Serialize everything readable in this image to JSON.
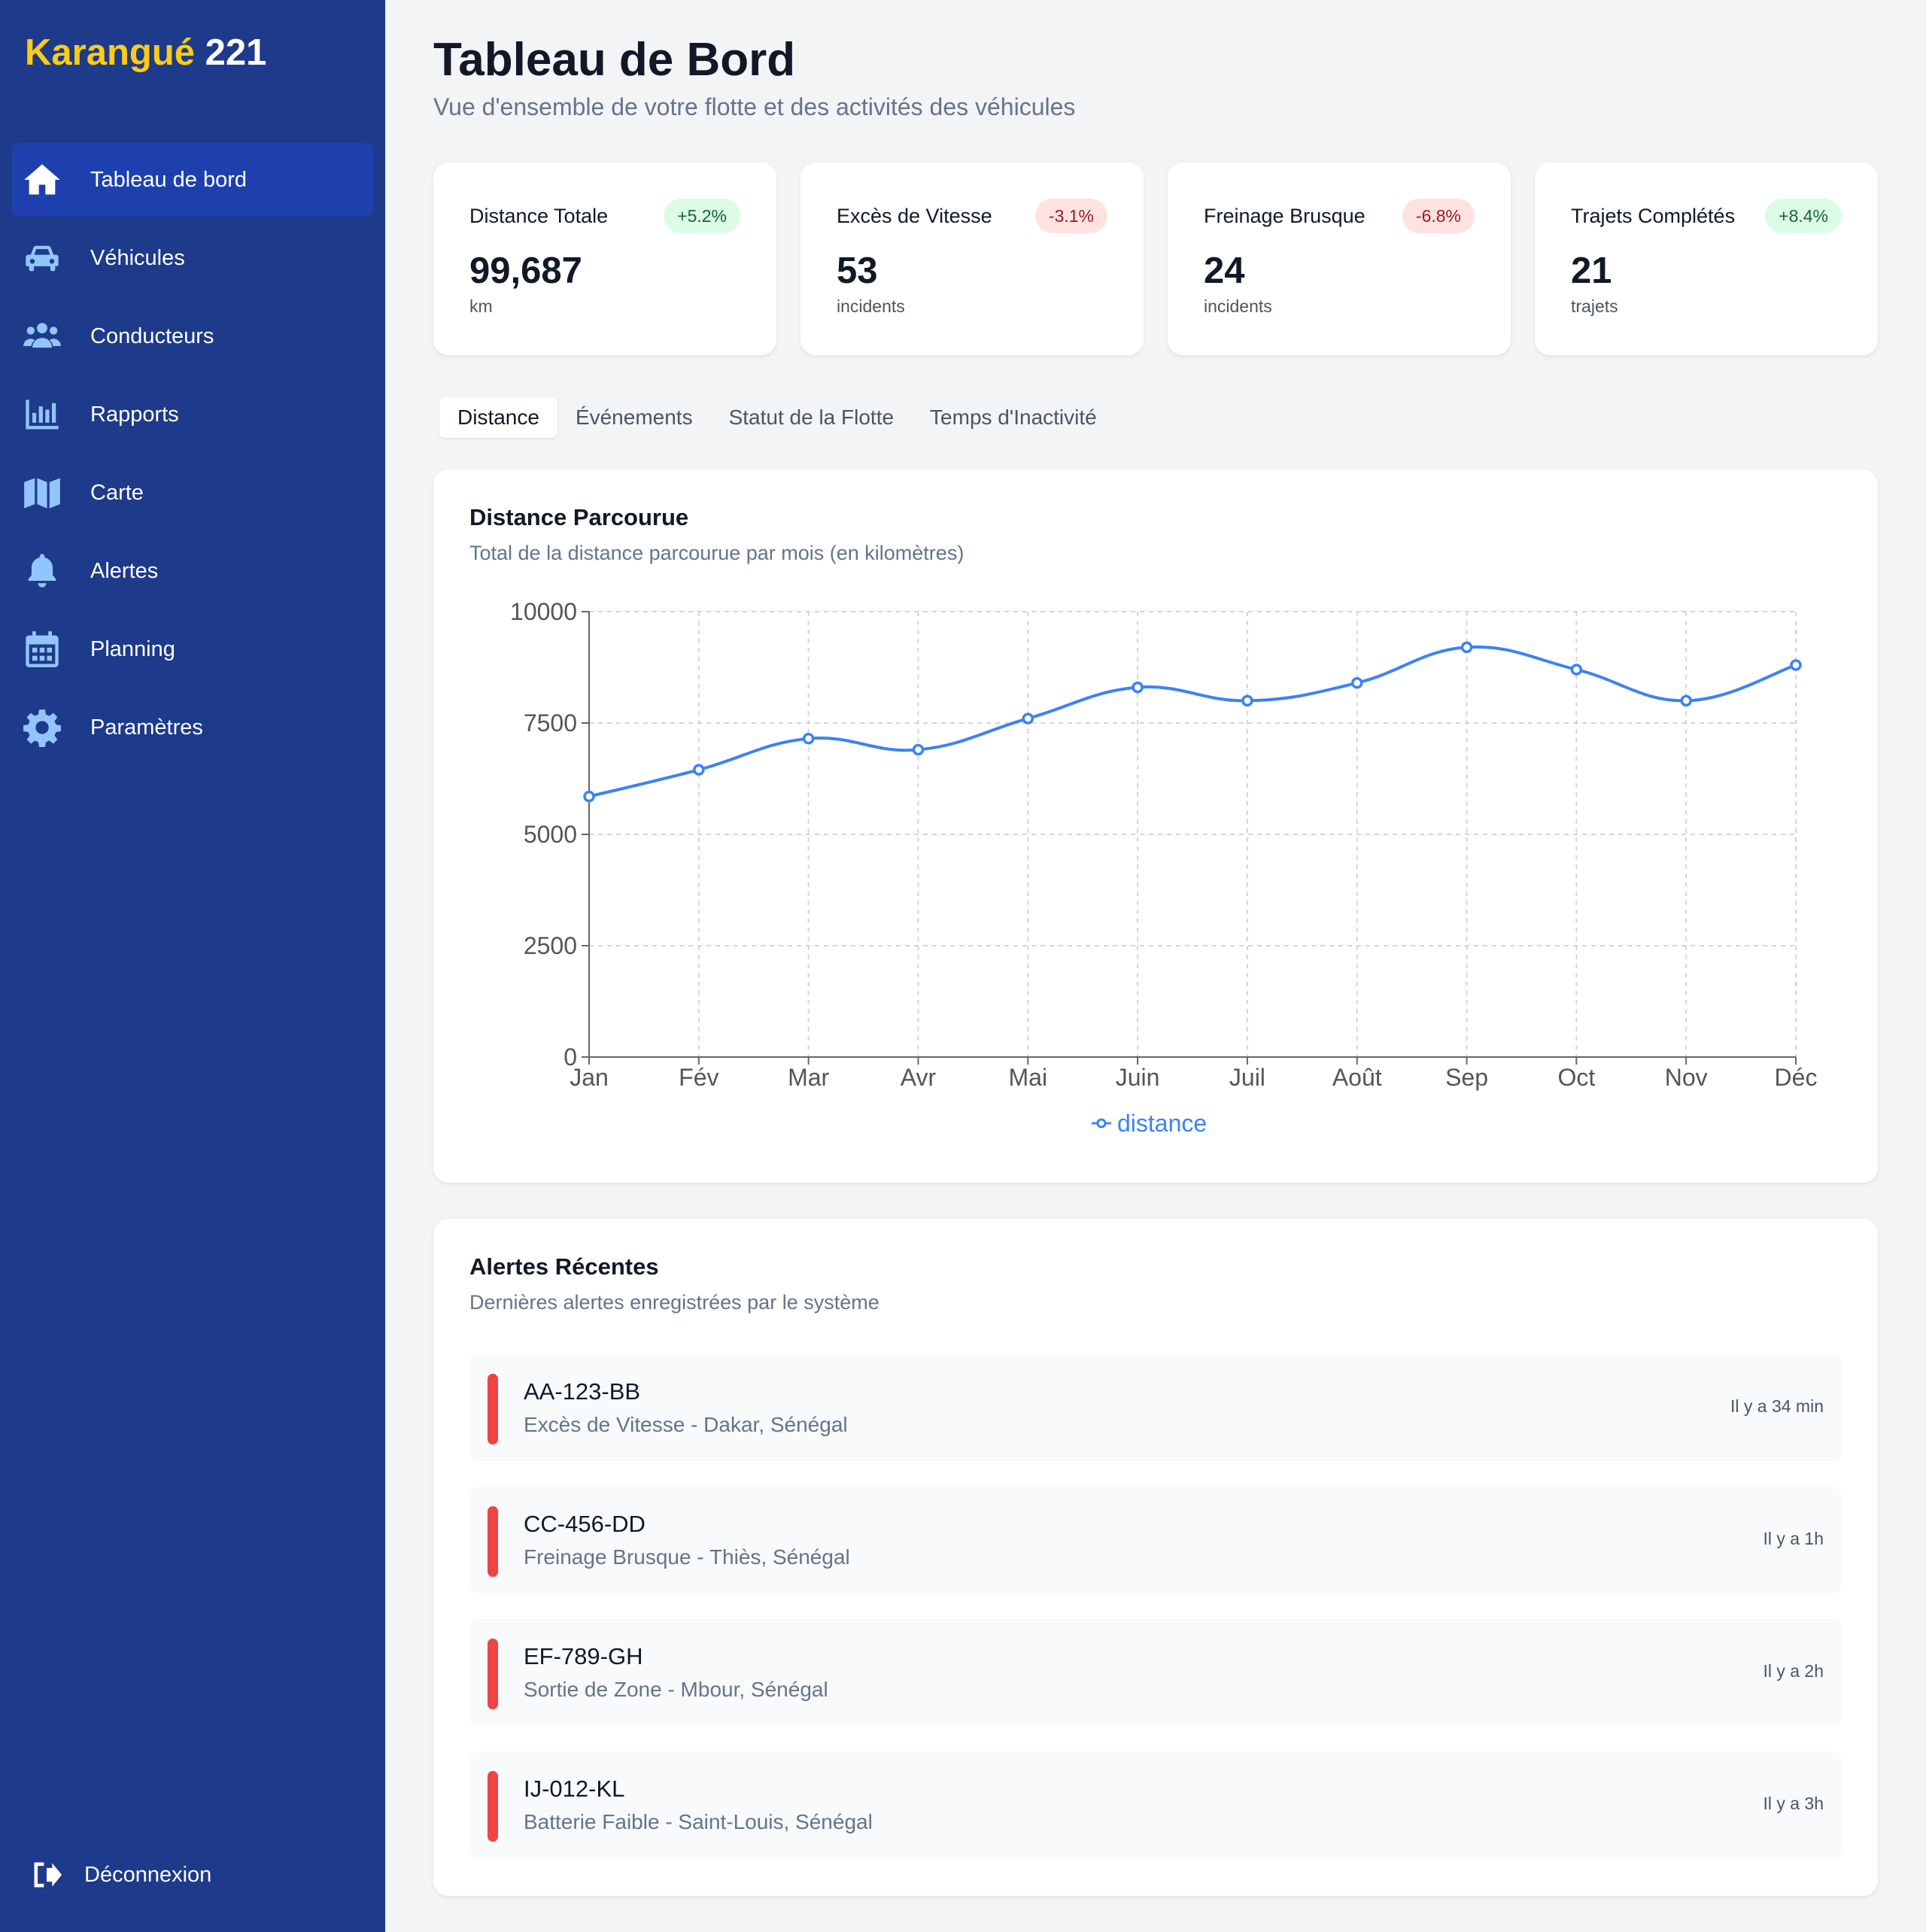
{
  "sidebar": {
    "brand_part1": "Karangué",
    "brand_part2": "221",
    "items": [
      {
        "label": "Tableau de bord",
        "icon": "home-icon",
        "active": true
      },
      {
        "label": "Véhicules",
        "icon": "car-icon"
      },
      {
        "label": "Conducteurs",
        "icon": "users-icon"
      },
      {
        "label": "Rapports",
        "icon": "bar-chart-icon"
      },
      {
        "label": "Carte",
        "icon": "map-icon"
      },
      {
        "label": "Alertes",
        "icon": "bell-icon"
      },
      {
        "label": "Planning",
        "icon": "calendar-icon"
      },
      {
        "label": "Paramètres",
        "icon": "gear-icon"
      }
    ],
    "logout_label": "Déconnexion"
  },
  "header": {
    "title": "Tableau de Bord",
    "subtitle": "Vue d'ensemble de votre flotte et des activités des véhicules"
  },
  "stats": [
    {
      "label": "Distance Totale",
      "change": "+5.2%",
      "trend": "positive",
      "value": "99,687",
      "unit": "km"
    },
    {
      "label": "Excès de Vitesse",
      "change": "-3.1%",
      "trend": "negative",
      "value": "53",
      "unit": "incidents"
    },
    {
      "label": "Freinage Brusque",
      "change": "-6.8%",
      "trend": "negative",
      "value": "24",
      "unit": "incidents"
    },
    {
      "label": "Trajets Complétés",
      "change": "+8.4%",
      "trend": "positive",
      "value": "21",
      "unit": "trajets"
    }
  ],
  "tabs": [
    {
      "label": "Distance",
      "active": true
    },
    {
      "label": "Événements"
    },
    {
      "label": "Statut de la Flotte"
    },
    {
      "label": "Temps d'Inactivité"
    }
  ],
  "chart_card": {
    "title": "Distance Parcourue",
    "subtitle": "Total de la distance parcourue par mois (en kilomètres)"
  },
  "chart_data": {
    "type": "line",
    "categories": [
      "Jan",
      "Fév",
      "Mar",
      "Avr",
      "Mai",
      "Juin",
      "Juil",
      "Août",
      "Sep",
      "Oct",
      "Nov",
      "Déc"
    ],
    "series": [
      {
        "name": "distance",
        "values": [
          5850,
          6450,
          7150,
          6900,
          7600,
          8300,
          8000,
          8400,
          9200,
          8700,
          8000,
          8800
        ],
        "color": "#3b82f6"
      }
    ],
    "ylim": [
      0,
      10000
    ],
    "yticks": [
      0,
      2500,
      5000,
      7500,
      10000
    ],
    "grid": true,
    "legend": "bottom-center"
  },
  "alerts_card": {
    "title": "Alertes Récentes",
    "subtitle": "Dernières alertes enregistrées par le système",
    "items": [
      {
        "plate": "AA-123-BB",
        "description": "Excès de Vitesse - Dakar, Sénégal",
        "time": "Il y a 34 min"
      },
      {
        "plate": "CC-456-DD",
        "description": "Freinage Brusque - Thiès, Sénégal",
        "time": "Il y a 1h"
      },
      {
        "plate": "EF-789-GH",
        "description": "Sortie de Zone - Mbour, Sénégal",
        "time": "Il y a 2h"
      },
      {
        "plate": "IJ-012-KL",
        "description": "Batterie Faible - Saint-Louis, Sénégal",
        "time": "Il y a 3h"
      }
    ]
  },
  "colors": {
    "sidebar_bg": "#1e3a8a",
    "sidebar_active": "#1e40af",
    "brand_accent": "#facc15",
    "chart_line": "#3b82f6",
    "alert_indicator": "#ef4444"
  }
}
